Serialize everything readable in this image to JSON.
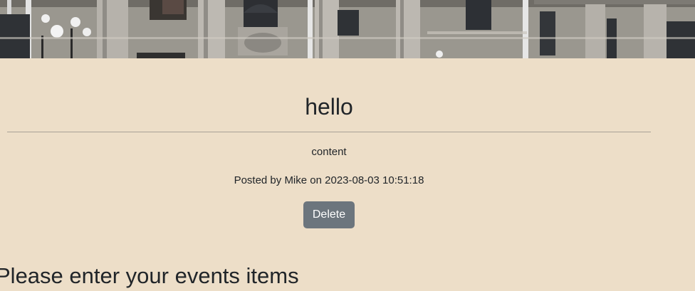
{
  "post": {
    "title": "hello",
    "content": "content",
    "meta": "Posted by Mike on 2023-08-03 10:51:18",
    "delete_label": "Delete"
  },
  "events": {
    "heading": "Please enter your events items"
  },
  "colors": {
    "page_background": "#eddec8",
    "button_background": "#6c757d",
    "button_text": "#ffffff",
    "text": "#212529"
  }
}
